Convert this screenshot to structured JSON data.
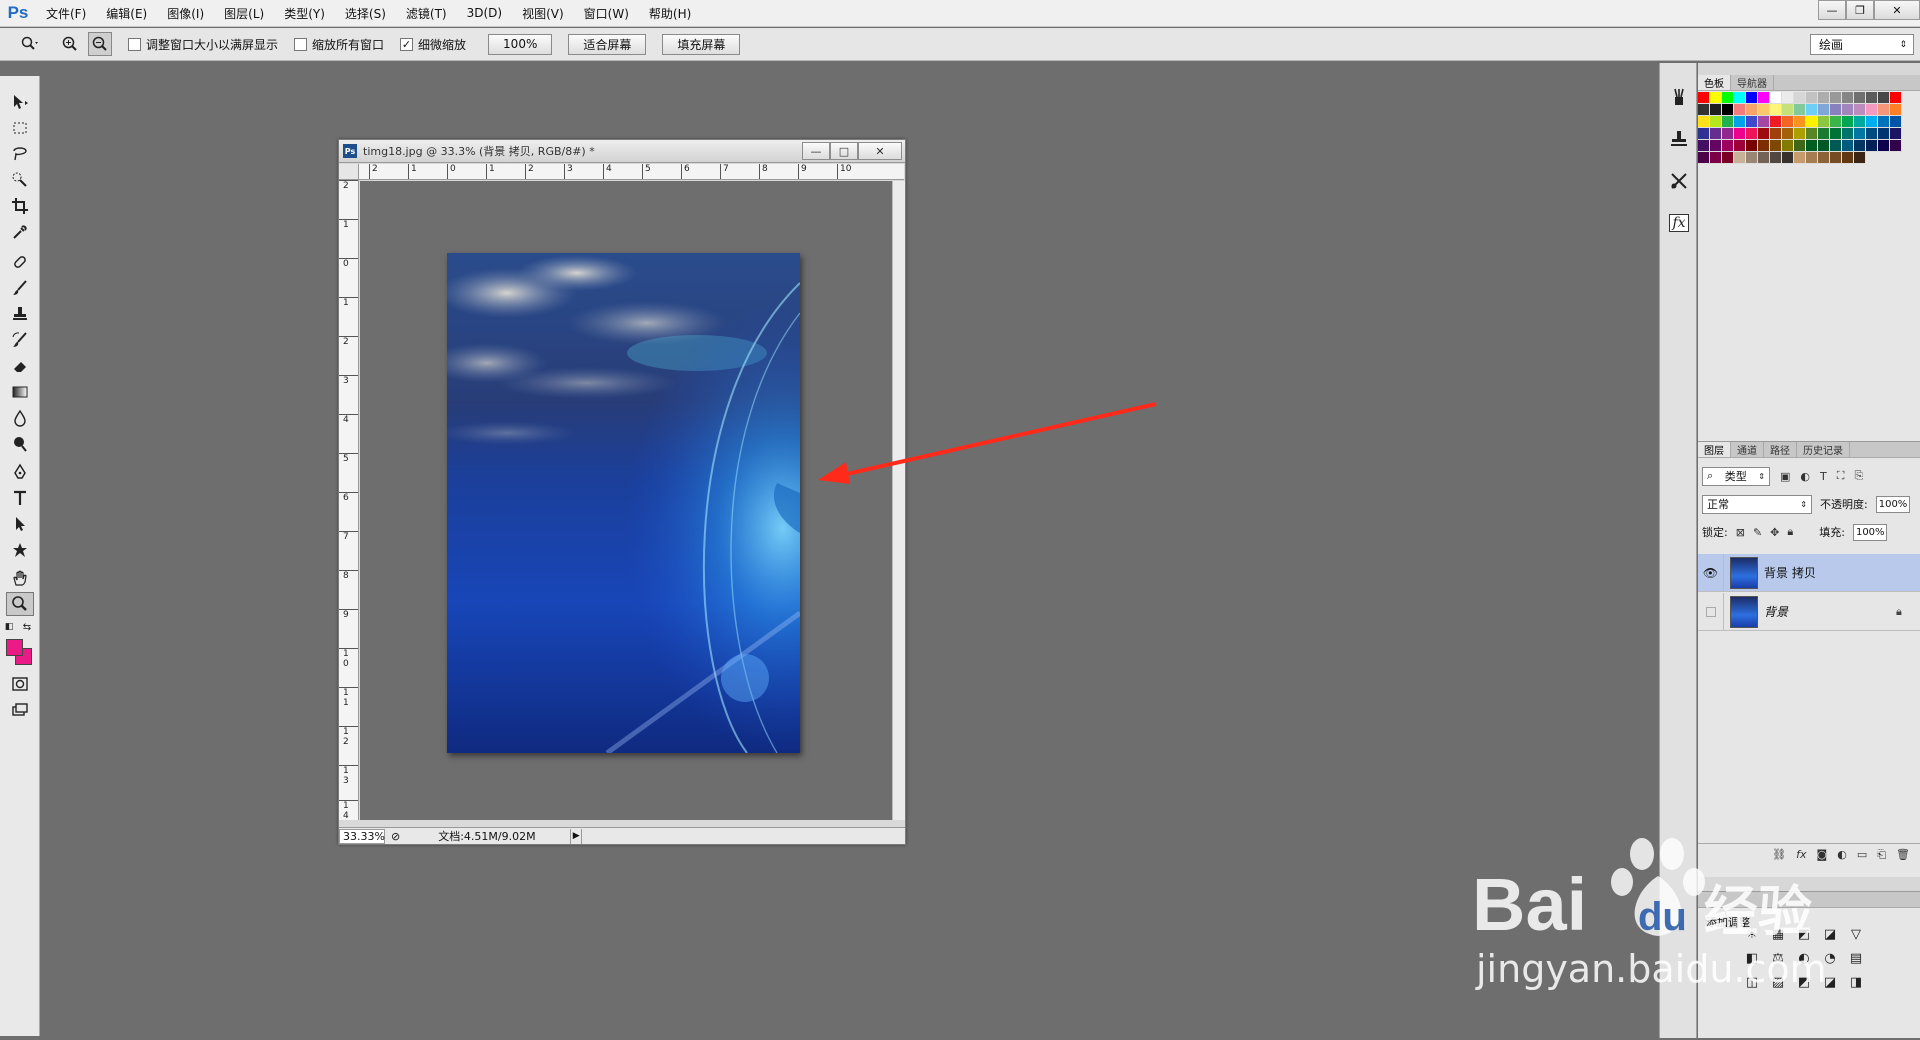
{
  "app": {
    "logo": "Ps",
    "menu": [
      "文件(F)",
      "编辑(E)",
      "图像(I)",
      "图层(L)",
      "类型(Y)",
      "选择(S)",
      "滤镜(T)",
      "3D(D)",
      "视图(V)",
      "窗口(W)",
      "帮助(H)"
    ],
    "window_controls": {
      "minimize": "—",
      "restore": "❐",
      "close": "✕"
    }
  },
  "options_bar": {
    "resize_windows_label": "调整窗口大小以满屏显示",
    "resize_windows_checked": false,
    "zoom_all_label": "缩放所有窗口",
    "zoom_all_checked": false,
    "scrubby_zoom_label": "细微缩放",
    "scrubby_zoom_checked": true,
    "actual_pixels_btn": "100%",
    "fit_screen_btn": "适合屏幕",
    "fill_screen_btn": "填充屏幕",
    "workspace": "绘画"
  },
  "document": {
    "title": "timg18.jpg @ 33.3% (背景 拷贝, RGB/8#) *",
    "ps_icon": "Ps",
    "zoom": "33.33%",
    "doc_info": "文档:4.51M/9.02M",
    "h_ruler": [
      "2",
      "1",
      "0",
      "1",
      "2",
      "3",
      "4",
      "5",
      "6",
      "7",
      "8",
      "9",
      "10"
    ],
    "v_ruler": [
      "2",
      "1",
      "0",
      "1",
      "2",
      "3",
      "4",
      "5",
      "6",
      "7",
      "8",
      "9",
      "1\n0",
      "1\n1",
      "1\n2",
      "1\n3",
      "1\n4"
    ]
  },
  "swatches_panel": {
    "tabs": [
      "色板",
      "导航器"
    ],
    "colors": [
      "#ff0000",
      "#ffff00",
      "#00ff00",
      "#00ffff",
      "#0000ff",
      "#ff00ff",
      "#ffffff",
      "#ebebeb",
      "#d6d6d6",
      "#c2c2c2",
      "#adadad",
      "#999999",
      "#858585",
      "#707070",
      "#5c5c5c",
      "#474747",
      "#ff0000",
      "#333333",
      "#1f1f1f",
      "#000000",
      "#f47b7b",
      "#f8a36a",
      "#fbc969",
      "#fff57a",
      "#c5e17a",
      "#82ca9c",
      "#6dcff6",
      "#7ea7d8",
      "#8781bd",
      "#a186be",
      "#bd8cbf",
      "#f49ac1",
      "#f7977a",
      "#ff7f27",
      "#ffe019",
      "#b5e61d",
      "#22b14c",
      "#00a2e8",
      "#3f48cc",
      "#a349a4",
      "#ed1c24",
      "#f26522",
      "#f7941d",
      "#fff200",
      "#8dc63f",
      "#39b54a",
      "#00a651",
      "#00a99d",
      "#00aeef",
      "#0072bc",
      "#0054a6",
      "#2e3192",
      "#662d91",
      "#92278f",
      "#ec008c",
      "#ed145b",
      "#9e0b0f",
      "#a0410d",
      "#a36209",
      "#aba000",
      "#598527",
      "#1a7b30",
      "#007236",
      "#00746b",
      "#0076a3",
      "#004b80",
      "#003471",
      "#1b1464",
      "#440e62",
      "#630460",
      "#9e005d",
      "#9e0039",
      "#790000",
      "#7b2e00",
      "#7d4900",
      "#827b00",
      "#406618",
      "#005e20",
      "#005826",
      "#005952",
      "#005b7f",
      "#003663",
      "#002157",
      "#0d004c",
      "#32004b",
      "#4b0049",
      "#7b0046",
      "#7a0026",
      "#c7b299",
      "#998675",
      "#736357",
      "#534741",
      "#37302d",
      "#c69c6d",
      "#a67c52",
      "#8c6239",
      "#754c24",
      "#603913",
      "#3c2415"
    ]
  },
  "layers_panel": {
    "tabs": [
      "图层",
      "通道",
      "路径",
      "历史记录"
    ],
    "filter_kind": "类型",
    "blend_mode": "正常",
    "opacity_label": "不透明度:",
    "opacity": "100%",
    "lock_label": "锁定:",
    "fill_label": "填充:",
    "fill": "100%",
    "layers": [
      {
        "name": "背景 拷贝",
        "visible": true,
        "selected": true,
        "locked": false
      },
      {
        "name": "背景",
        "visible": false,
        "selected": false,
        "locked": true
      }
    ]
  },
  "adjustments_panel": {
    "title": "添加调整",
    "icons": [
      "☀",
      "▦",
      "◩",
      "◪",
      "▽",
      "◧",
      "⚖",
      "◐",
      "◔",
      "▤",
      "◫",
      "▨",
      "◩",
      "◪",
      "◨"
    ]
  },
  "annotation": {
    "arrow_color": "#ff2a1a"
  },
  "watermark": {
    "brand": "Bai",
    "brand_du": "du",
    "suffix": "经验",
    "url": "jingyan.baidu.com"
  },
  "colors": {
    "foreground": "#ea1b86",
    "background": "#ea1b86"
  }
}
